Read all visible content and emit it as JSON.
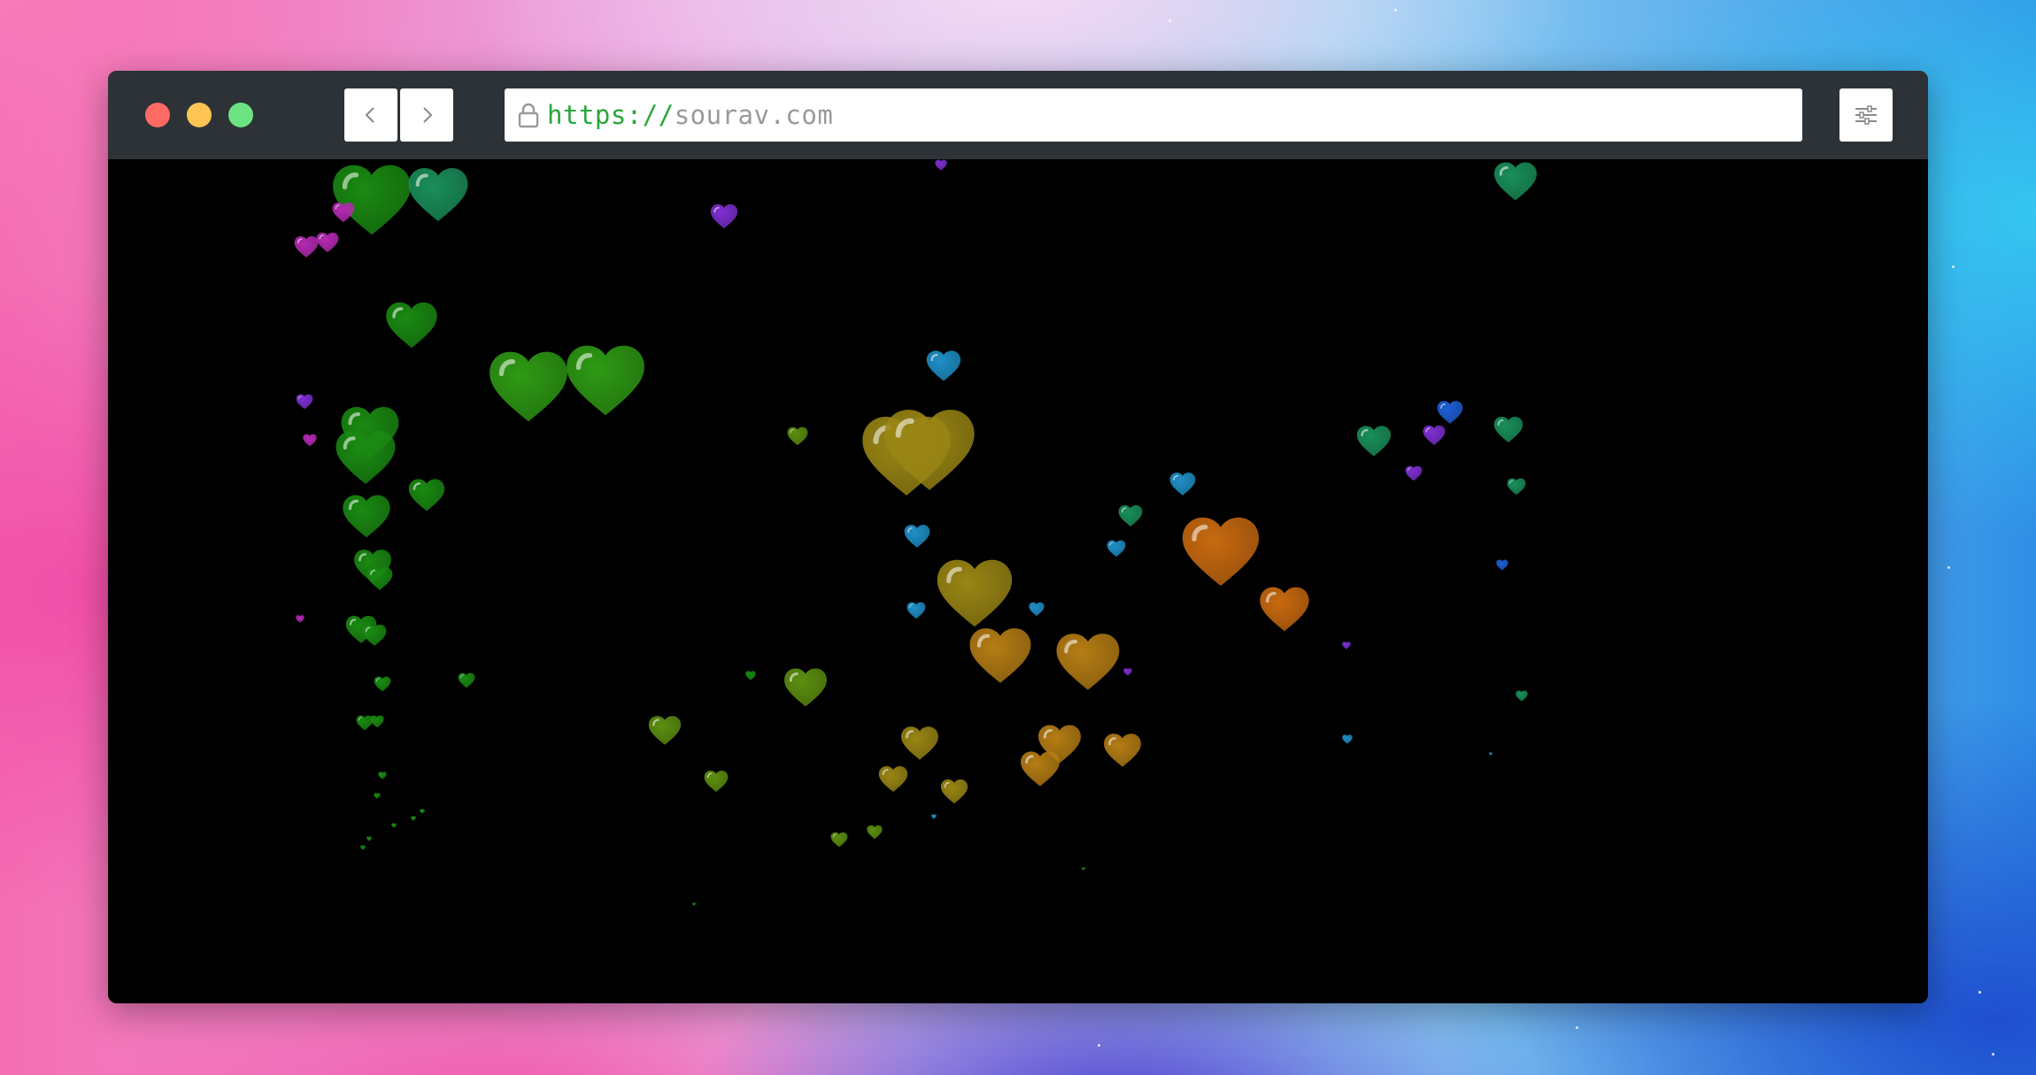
{
  "browser": {
    "url_scheme": "https://",
    "url_host": "sourav.com",
    "colors": {
      "traffic_close": "#ff6a63",
      "traffic_minimize": "#fec554",
      "traffic_maximize": "#6ce383",
      "toolbar": "#2d3236",
      "url_scheme": "#2aa53a",
      "url_host": "#9a9a9a"
    }
  },
  "icons": {
    "back": "chevron-left-icon",
    "forward": "chevron-right-icon",
    "lock": "lock-icon",
    "settings": "sliders-icon"
  },
  "animation": {
    "name": "floating-hearts",
    "heart_palette": [
      "#1a8a12",
      "#2e9a14",
      "#5d8f10",
      "#9a8614",
      "#b57d14",
      "#c86a10",
      "#1a8f5a",
      "#1f8fc7",
      "#1e5fd6",
      "#7d2fd0",
      "#b52ab3"
    ]
  }
}
